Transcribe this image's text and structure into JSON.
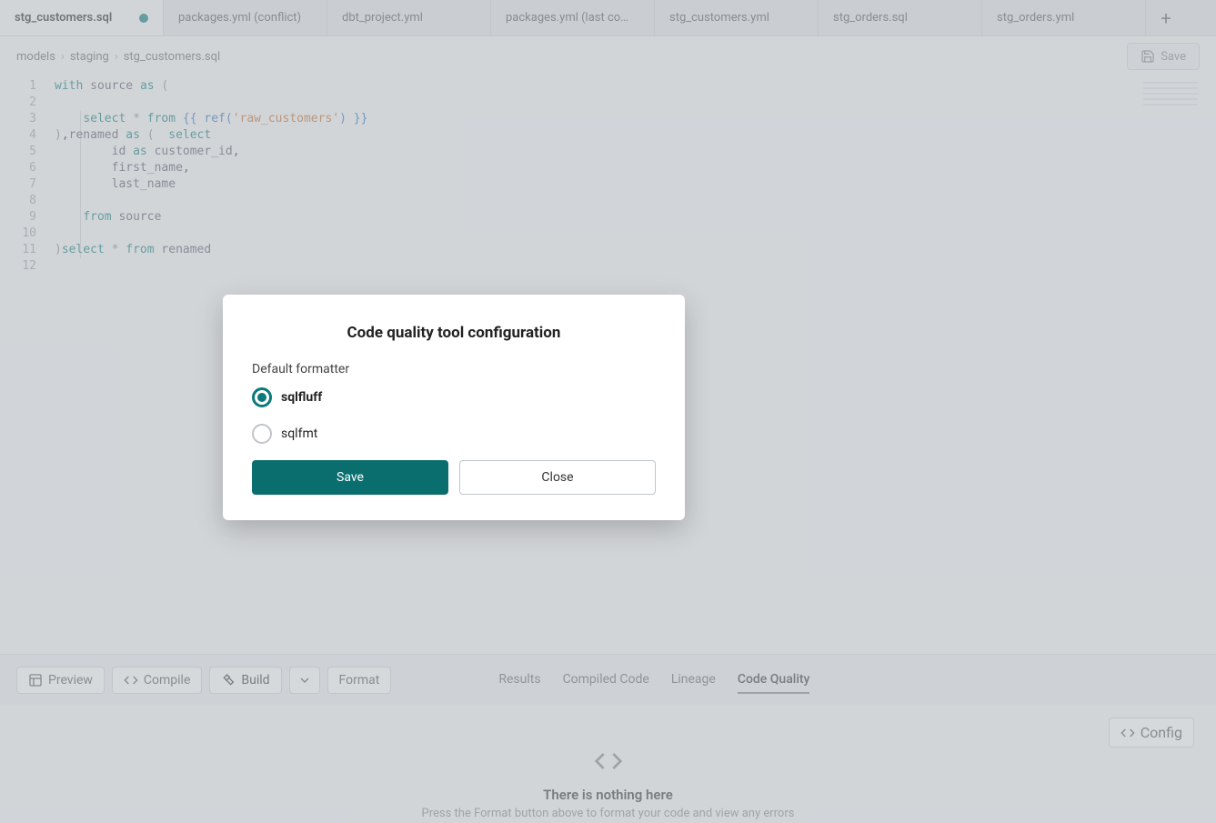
{
  "tabs": [
    {
      "label": "stg_customers.sql",
      "active": true,
      "dirty": true
    },
    {
      "label": "packages.yml (conflict)"
    },
    {
      "label": "dbt_project.yml"
    },
    {
      "label": "packages.yml (last co…"
    },
    {
      "label": "stg_customers.yml"
    },
    {
      "label": "stg_orders.sql"
    },
    {
      "label": "stg_orders.yml"
    }
  ],
  "breadcrumbs": [
    "models",
    "staging",
    "stg_customers.sql"
  ],
  "save_button": "Save",
  "line_numbers": [
    "1",
    "2",
    "3",
    "4",
    "5",
    "6",
    "7",
    "8",
    "9",
    "10",
    "11",
    "12"
  ],
  "code_lines_html": [
    "<span class='tok-kw'>with</span> <span class='tok-id'>source</span> <span class='tok-kw'>as</span> <span class='tok-punc'>(</span>",
    "",
    "    <span class='tok-kw'>select</span> <span class='tok-punc'>*</span> <span class='tok-kw'>from</span> <span class='tok-brace'>{{</span> <span class='tok-fn'>ref(</span><span class='tok-str'>'raw_customers'</span><span class='tok-fn'>)</span> <span class='tok-brace'>}}</span>",
    "<span class='tok-punc'>)</span>,<span class='tok-id'>renamed</span> <span class='tok-kw'>as</span> <span class='tok-punc'>(</span>  <span class='tok-kw'>select</span>",
    "        <span class='tok-id'>id</span> <span class='tok-kw'>as</span> <span class='tok-id'>customer_id</span>,",
    "        <span class='tok-id'>first_name</span>,",
    "        <span class='tok-id'>last_name</span>",
    "",
    "    <span class='tok-kw'>from</span> <span class='tok-id'>source</span>",
    "",
    "<span class='tok-punc'>)</span><span class='tok-kw'>select</span> <span class='tok-punc'>*</span> <span class='tok-kw'>from</span> <span class='tok-id'>renamed</span>",
    ""
  ],
  "toolbar": {
    "preview": "Preview",
    "compile": "Compile",
    "build": "Build",
    "format": "Format"
  },
  "panel_tabs": [
    "Results",
    "Compiled Code",
    "Lineage",
    "Code Quality"
  ],
  "panel_active_tab": "Code Quality",
  "config_button": "Config",
  "empty": {
    "title": "There is nothing here",
    "subtitle": "Press the Format button above to format your code and view any errors"
  },
  "modal": {
    "title": "Code quality tool configuration",
    "label": "Default formatter",
    "options": [
      {
        "value": "sqlfluff",
        "selected": true
      },
      {
        "value": "sqlfmt",
        "selected": false
      }
    ],
    "save": "Save",
    "close": "Close"
  }
}
